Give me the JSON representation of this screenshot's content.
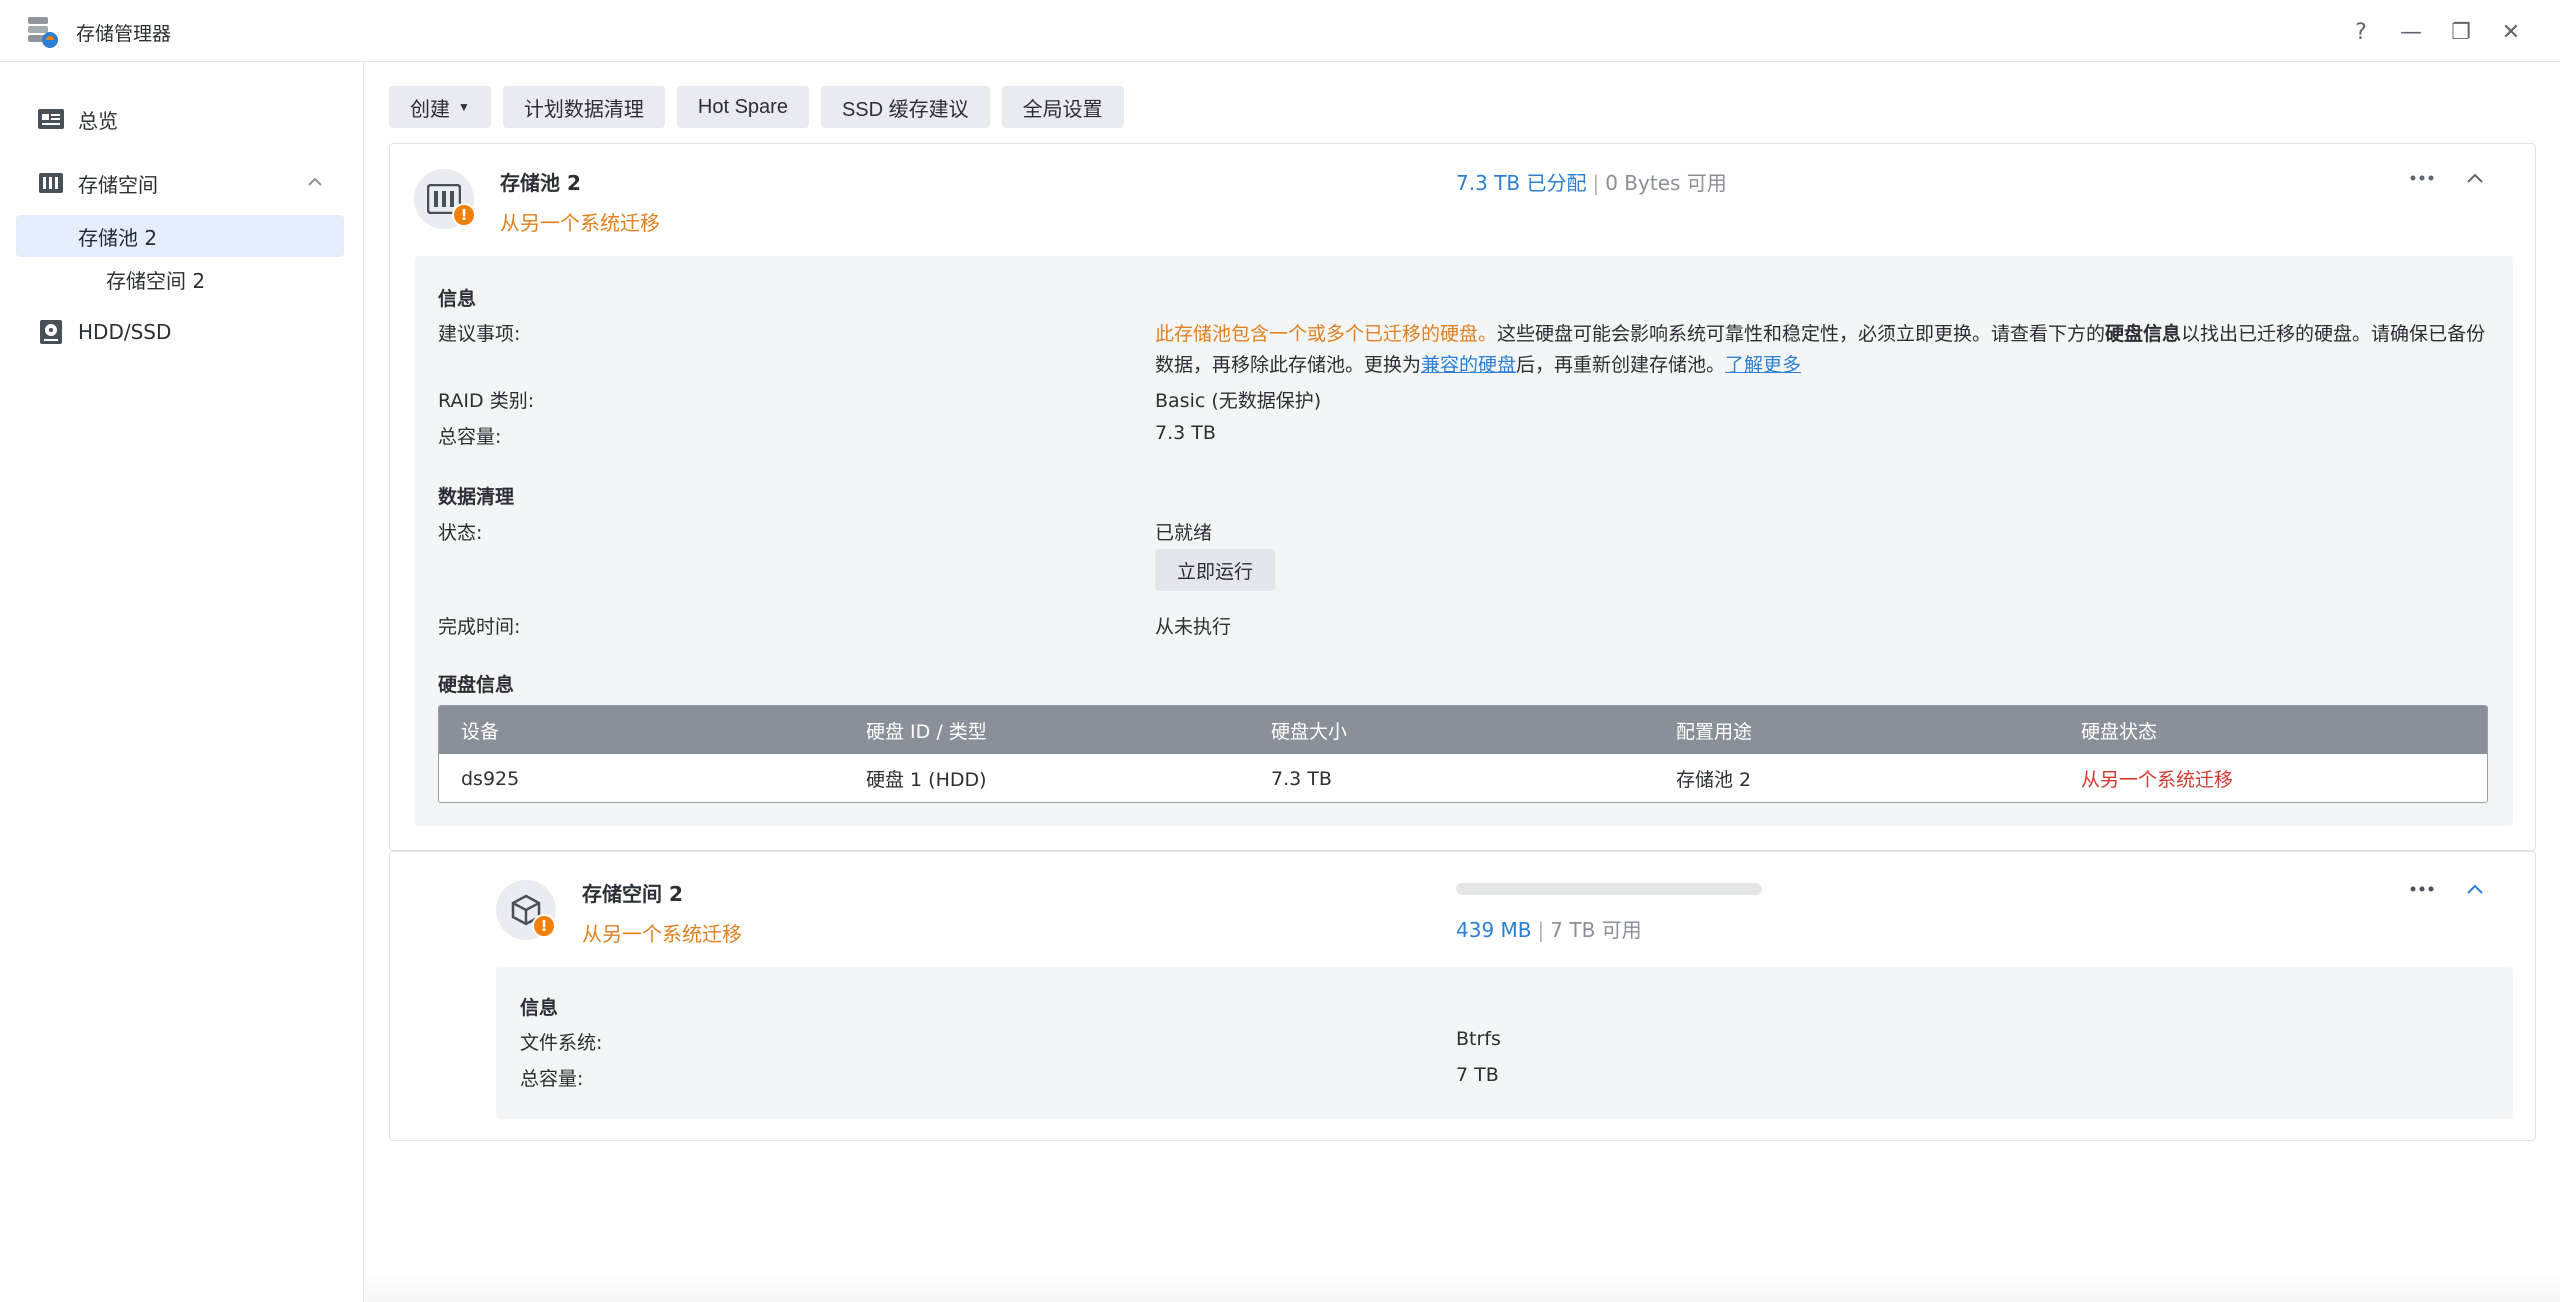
{
  "window": {
    "title": "存储管理器",
    "controls": {
      "help": "?",
      "minimize": "—",
      "restore": "❐",
      "close": "✕"
    }
  },
  "sidebar": {
    "items": [
      {
        "label": "总览",
        "icon": "overview-icon"
      },
      {
        "label": "存储空间",
        "icon": "storage-icon",
        "expanded": true
      },
      {
        "label": "存储池 2",
        "active": true
      },
      {
        "label": "存储空间 2"
      },
      {
        "label": "HDD/SSD",
        "icon": "disk-icon"
      }
    ]
  },
  "toolbar": {
    "create": "创建",
    "scrub": "计划数据清理",
    "hotspare": "Hot Spare",
    "ssd": "SSD 缓存建议",
    "global": "全局设置"
  },
  "pool": {
    "title": "存储池 2",
    "status": "从另一个系统迁移",
    "used": "7.3 TB 已分配",
    "separator": "|",
    "available": "0 Bytes 可用",
    "info_title": "信息",
    "advice_label": "建议事项:",
    "advice_warn": "此存储池包含一个或多个已迁移的硬盘。",
    "advice_text1": "这些硬盘可能会影响系统可靠性和稳定性，必须立即更换。请查看下方的",
    "advice_bold": "硬盘信息",
    "advice_text2": "以找出已迁移的硬盘。请确保",
    "advice_text3": "已备份数据，再移除此存储池。更换为",
    "advice_link1": "兼容的硬盘",
    "advice_text4": "后，再重新创建存储池。",
    "advice_link2": "了解更多",
    "raid_label": "RAID 类别:",
    "raid_value": "Basic (无数据保护)",
    "capacity_label": "总容量:",
    "capacity_value": "7.3 TB",
    "scrub_title": "数据清理",
    "state_label": "状态:",
    "state_value": "已就绪",
    "run_now": "立即运行",
    "done_label": "完成时间:",
    "done_value": "从未执行",
    "disk_title": "硬盘信息",
    "disk_headers": [
      "设备",
      "硬盘 ID / 类型",
      "硬盘大小",
      "配置用途",
      "硬盘状态"
    ],
    "disk_rows": [
      [
        "ds925",
        "硬盘 1 (HDD)",
        "7.3 TB",
        "存储池 2",
        "从另一个系统迁移"
      ]
    ]
  },
  "volume": {
    "title": "存储空间 2",
    "status": "从另一个系统迁移",
    "used": "439 MB",
    "separator": "|",
    "available": "7 TB 可用",
    "progress_fraction": 0.0001,
    "info_title": "信息",
    "fs_label": "文件系统:",
    "fs_value": "Btrfs",
    "capacity_label": "总容量:",
    "capacity_value": "7 TB"
  },
  "colors": {
    "accent": "#2d7fd3",
    "warning": "#e0801f",
    "error": "#d33a2f"
  }
}
